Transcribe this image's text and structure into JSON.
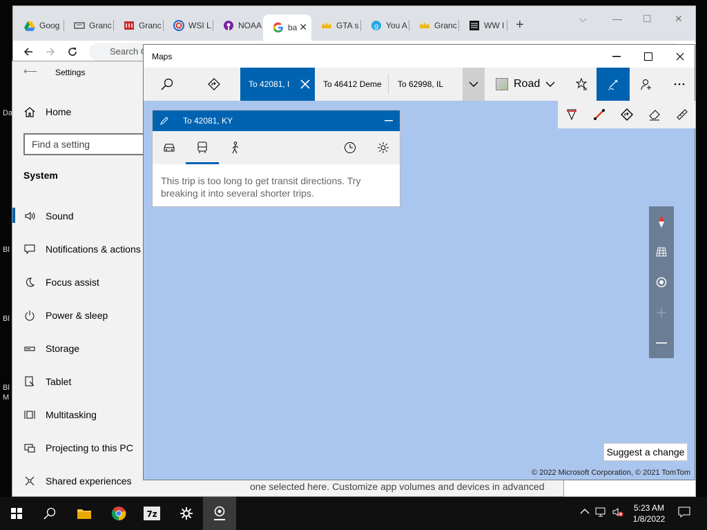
{
  "desktop": {
    "labels": [
      "Da",
      "Bl",
      "Bl",
      "Bl",
      "M"
    ]
  },
  "chrome": {
    "tabs": [
      {
        "label": "Goog",
        "icon": "google-drive-icon"
      },
      {
        "label": "Granc",
        "icon": "page-icon"
      },
      {
        "label": "Granc",
        "icon": "wrestling-icon"
      },
      {
        "label": "WSI L",
        "icon": "wsi-icon"
      },
      {
        "label": "NOAA",
        "icon": "podcast-icon"
      },
      {
        "label": "ba",
        "icon": "google-icon"
      },
      {
        "label": "GTA s",
        "icon": "crown-icon"
      },
      {
        "label": "You A",
        "icon": "g-circle-icon"
      },
      {
        "label": "Granc",
        "icon": "crown-icon"
      },
      {
        "label": "WW I",
        "icon": "weather-icon"
      }
    ],
    "omnibox_text": "Search G"
  },
  "settings": {
    "title": "Settings",
    "home": "Home",
    "search_placeholder": "Find a setting",
    "section": "System",
    "items": [
      {
        "label": "Sound",
        "icon": "speaker-icon"
      },
      {
        "label": "Notifications & actions",
        "icon": "notification-icon"
      },
      {
        "label": "Focus assist",
        "icon": "moon-icon"
      },
      {
        "label": "Power & sleep",
        "icon": "power-icon"
      },
      {
        "label": "Storage",
        "icon": "storage-icon"
      },
      {
        "label": "Tablet",
        "icon": "tablet-icon"
      },
      {
        "label": "Multitasking",
        "icon": "multitasking-icon"
      },
      {
        "label": "Projecting to this PC",
        "icon": "projecting-icon"
      },
      {
        "label": "Shared experiences",
        "icon": "shared-icon"
      }
    ],
    "bottom_text": "one selected here. Customize app volumes and devices in advanced"
  },
  "maps": {
    "title": "Maps",
    "route_tabs": [
      "To 42081, I",
      "To 46412 Deme",
      "To 62998, IL"
    ],
    "road_label": "Road",
    "directions": {
      "title": "To 42081, KY",
      "message": "This trip is too long to get transit directions. Try breaking it into several shorter trips."
    },
    "suggest_label": "Suggest a change",
    "copyright": "© 2022 Microsoft Corporation, © 2021 TomTom"
  },
  "taskbar": {
    "time": "5:23 AM",
    "date": "1/8/2022"
  }
}
